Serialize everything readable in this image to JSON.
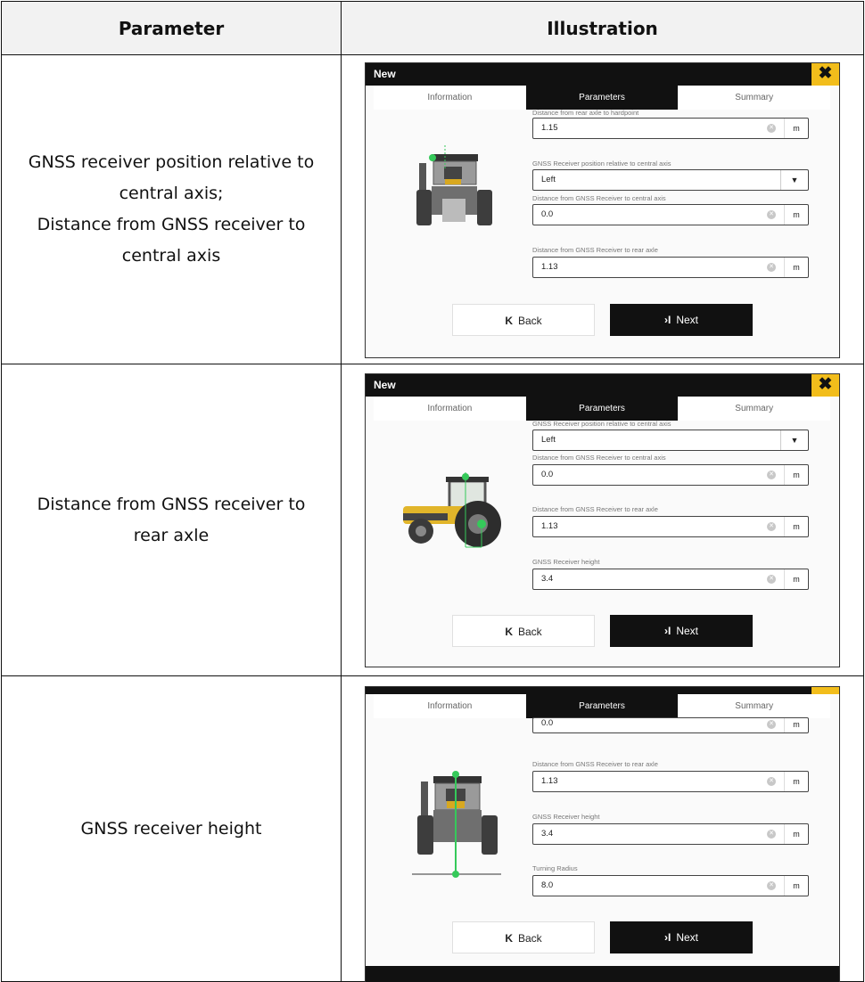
{
  "table": {
    "header_param": "Parameter",
    "header_illus": "Illustration"
  },
  "rows": [
    {
      "param_lines": [
        "GNSS receiver position relative to",
        "central axis;",
        "Distance from GNSS receiver to",
        "central axis"
      ],
      "screen": {
        "title": "New",
        "close_icon": "✖",
        "tabs": [
          "Information",
          "Parameters",
          "Summary"
        ],
        "fields": [
          {
            "label": "Distance from rear axle to hardpoint",
            "value": "1.15",
            "unit": "m"
          },
          {
            "label": "GNSS Receiver position relative to central axis",
            "value": "Left",
            "dropdown": "▼"
          },
          {
            "label": "Distance from GNSS Receiver to central axis",
            "value": "0.0",
            "unit": "m"
          },
          {
            "label": "Distance from GNSS Receiver to rear axle",
            "value": "1.13",
            "unit": "m"
          }
        ],
        "back": {
          "icon": "K",
          "label": "Back"
        },
        "next": {
          "icon": "›I",
          "label": "Next"
        }
      }
    },
    {
      "param_lines": [
        "Distance from GNSS receiver to",
        "rear axle"
      ],
      "screen": {
        "title": "New",
        "close_icon": "✖",
        "tabs": [
          "Information",
          "Parameters",
          "Summary"
        ],
        "fields": [
          {
            "label": "GNSS Receiver position relative to central axis",
            "value": "Left",
            "dropdown": "▼"
          },
          {
            "label": "Distance from GNSS Receiver to central axis",
            "value": "0.0",
            "unit": "m"
          },
          {
            "label": "Distance from GNSS Receiver to rear axle",
            "value": "1.13",
            "unit": "m"
          },
          {
            "label": "GNSS Receiver height",
            "value": "3.4",
            "unit": "m"
          }
        ],
        "back": {
          "icon": "K",
          "label": "Back"
        },
        "next": {
          "icon": "›I",
          "label": "Next"
        }
      }
    },
    {
      "param_lines": [
        "GNSS receiver height"
      ],
      "screen": {
        "tabs": [
          "Information",
          "Parameters",
          "Summary"
        ],
        "fields": [
          {
            "label": "",
            "value": "0.0",
            "unit": "m"
          },
          {
            "label": "Distance from GNSS Receiver to rear axle",
            "value": "1.13",
            "unit": "m"
          },
          {
            "label": "GNSS Receiver height",
            "value": "3.4",
            "unit": "m"
          },
          {
            "label": "Turning Radius",
            "value": "8.0",
            "unit": "m"
          }
        ],
        "back": {
          "icon": "K",
          "label": "Back"
        },
        "next": {
          "icon": "›I",
          "label": "Next"
        }
      }
    }
  ],
  "colors": {
    "accent": "#f2bd1b",
    "dark": "#111111",
    "marker": "#35c95a"
  }
}
